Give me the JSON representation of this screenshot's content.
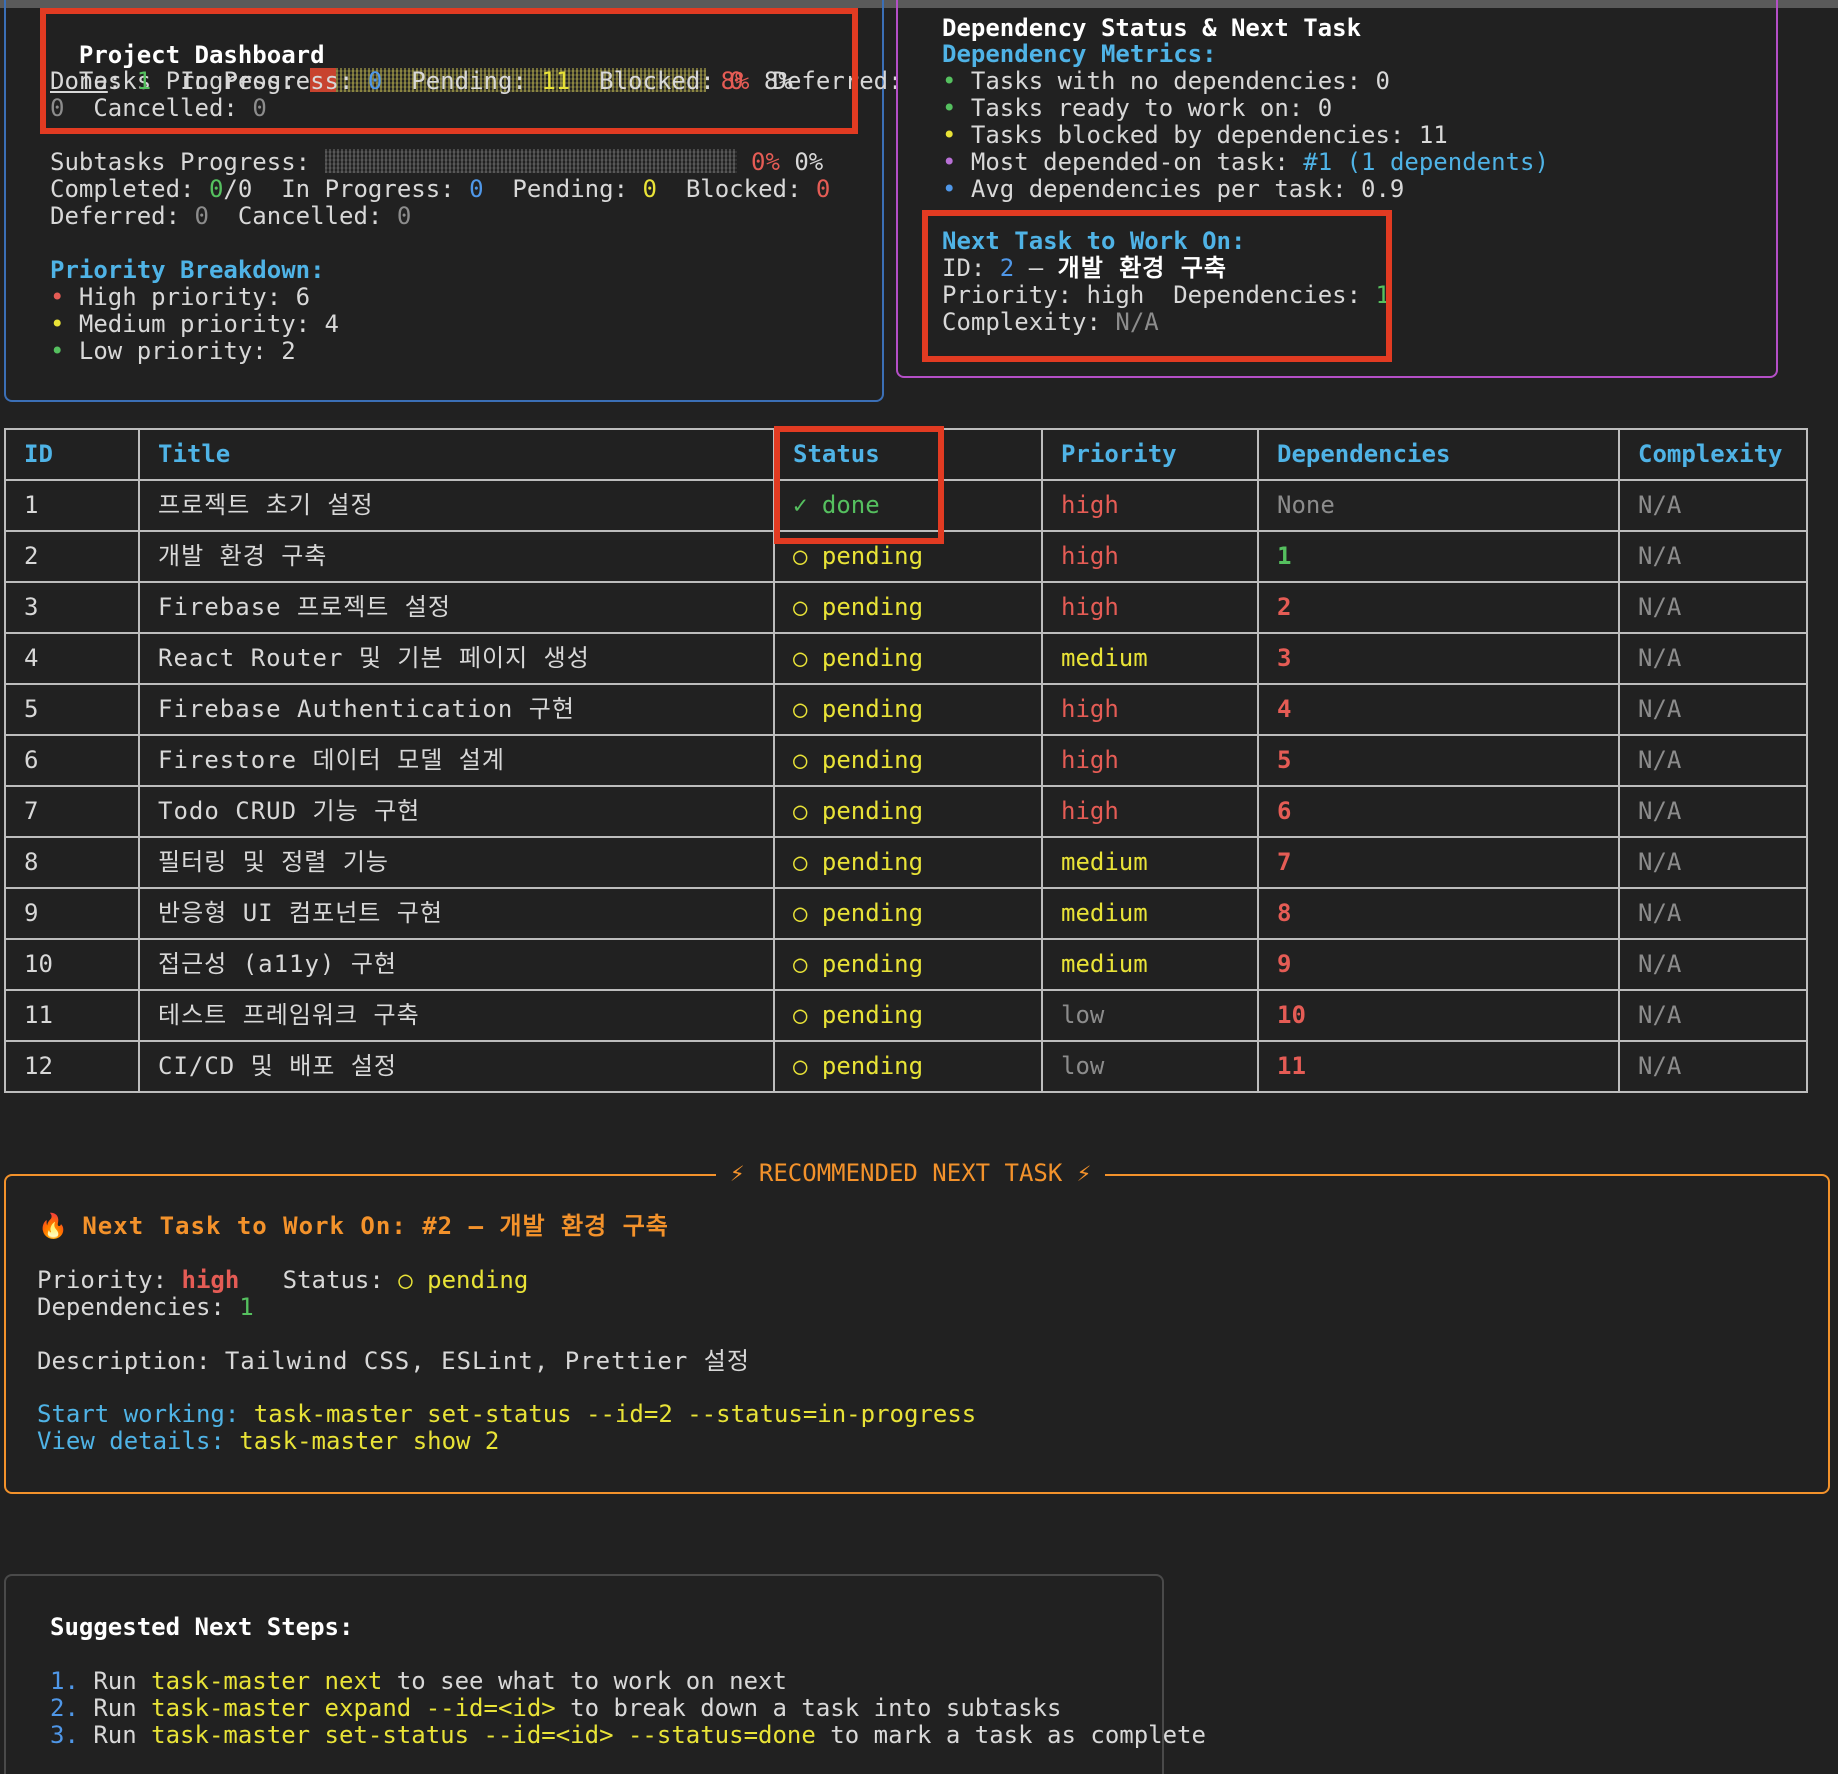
{
  "dashboard": {
    "title": "Project Dashboard",
    "tasks_progress_label": "Tasks Progress:",
    "tasks_pct_colored": "8%",
    "tasks_pct_plain": "8%",
    "tasks_progress_fraction": 0.08,
    "done_label": "Done",
    "done_value": "1",
    "in_progress_label": "In Progress:",
    "in_progress_value": "0",
    "pending_label": "Pending:",
    "pending_value": "11",
    "blocked_label": "Blocked:",
    "blocked_value": "0",
    "deferred_label": "Deferred:",
    "deferred_value": "0",
    "cancelled_label": "Cancelled:",
    "cancelled_value": "0",
    "subtasks_label": "Subtasks Progress:",
    "subtasks_pct_colored": "0%",
    "subtasks_pct_plain": "0%",
    "subtasks_progress_fraction": 0,
    "completed_label": "Completed:",
    "completed_value": "0",
    "completed_total": "0",
    "sub_in_progress_value": "0",
    "sub_pending_value": "0",
    "sub_blocked_value": "0",
    "sub_deferred_value": "0",
    "sub_cancelled_value": "0",
    "priority_title": "Priority Breakdown:",
    "priority_high": "High priority: 6",
    "priority_medium": "Medium priority: 4",
    "priority_low": "Low priority: 2"
  },
  "dependency": {
    "title": "Dependency Status & Next Task",
    "metrics_title": "Dependency Metrics:",
    "m1": "Tasks with no dependencies: 0",
    "m2": "Tasks ready to work on: 0",
    "m3": "Tasks blocked by dependencies: 11",
    "m4_label": "Most depended-on task: ",
    "m4_value": "#1 (1 dependents)",
    "m5": "Avg dependencies per task: 0.9",
    "next_title": "Next Task to Work On:",
    "next_id_label": "ID: ",
    "next_id": "2",
    "next_sep": " – ",
    "next_name": "개발 환경 구축",
    "next_priority_label": "Priority: ",
    "next_priority": "high",
    "next_deps_label": "Dependencies: ",
    "next_deps": "1",
    "next_complexity_label": "Complexity: ",
    "next_complexity": "N/A"
  },
  "table": {
    "headers": [
      "ID",
      "Title",
      "Status",
      "Priority",
      "Dependencies",
      "Complexity"
    ],
    "rows": [
      {
        "id": "1",
        "title": "프로젝트 초기 설정",
        "status": "✓ done",
        "priority": "high",
        "deps": "None",
        "complexity": "N/A"
      },
      {
        "id": "2",
        "title": "개발 환경 구축",
        "status": "○ pending",
        "priority": "high",
        "deps": "1",
        "complexity": "N/A"
      },
      {
        "id": "3",
        "title": "Firebase 프로젝트 설정",
        "status": "○ pending",
        "priority": "high",
        "deps": "2",
        "complexity": "N/A"
      },
      {
        "id": "4",
        "title": "React Router 및 기본 페이지 생성",
        "status": "○ pending",
        "priority": "medium",
        "deps": "3",
        "complexity": "N/A"
      },
      {
        "id": "5",
        "title": "Firebase Authentication 구현",
        "status": "○ pending",
        "priority": "high",
        "deps": "4",
        "complexity": "N/A"
      },
      {
        "id": "6",
        "title": "Firestore 데이터 모델 설계",
        "status": "○ pending",
        "priority": "high",
        "deps": "5",
        "complexity": "N/A"
      },
      {
        "id": "7",
        "title": "Todo CRUD 기능 구현",
        "status": "○ pending",
        "priority": "high",
        "deps": "6",
        "complexity": "N/A"
      },
      {
        "id": "8",
        "title": "필터링 및 정렬 기능",
        "status": "○ pending",
        "priority": "medium",
        "deps": "7",
        "complexity": "N/A"
      },
      {
        "id": "9",
        "title": "반응형 UI 컴포넌트 구현",
        "status": "○ pending",
        "priority": "medium",
        "deps": "8",
        "complexity": "N/A"
      },
      {
        "id": "10",
        "title": "접근성 (a11y) 구현",
        "status": "○ pending",
        "priority": "medium",
        "deps": "9",
        "complexity": "N/A"
      },
      {
        "id": "11",
        "title": "테스트 프레임워크 구축",
        "status": "○ pending",
        "priority": "low",
        "deps": "10",
        "complexity": "N/A"
      },
      {
        "id": "12",
        "title": "CI/CD 및 배포 설정",
        "status": "○ pending",
        "priority": "low",
        "deps": "11",
        "complexity": "N/A"
      }
    ]
  },
  "recommended": {
    "banner": "⚡ RECOMMENDED NEXT TASK ⚡",
    "heading": "Next Task to Work On: #2 – 개발 환경 구축",
    "priority_label": "Priority: ",
    "priority_value": "high",
    "status_label": "Status: ",
    "status_value": "○ pending",
    "deps_label": "Dependencies: ",
    "deps_value": "1",
    "desc_label": "Description: ",
    "desc_value": "Tailwind CSS, ESLint, Prettier 설정",
    "start_label": "Start working: ",
    "start_cmd": "task-master set-status --id=2 --status=in-progress",
    "view_label": "View details: ",
    "view_cmd": "task-master show 2"
  },
  "steps": {
    "title": "Suggested Next Steps:",
    "items": [
      {
        "num": "1.",
        "pre": "Run ",
        "cmd": "task-master next",
        "post": " to see what to work on next"
      },
      {
        "num": "2.",
        "pre": "Run ",
        "cmd": "task-master expand --id=<id>",
        "post": " to break down a task into subtasks"
      },
      {
        "num": "3.",
        "pre": "Run ",
        "cmd": "task-master set-status --id=<id> --status=done",
        "post": " to mark a task as complete"
      }
    ]
  },
  "colors": {
    "background": "#212121",
    "blue_border": "#3b6fb6",
    "purple_border": "#b44fc7",
    "orange_border": "#f3922b",
    "highlight_red": "#e23b22",
    "progress_red": "#c8432e"
  }
}
